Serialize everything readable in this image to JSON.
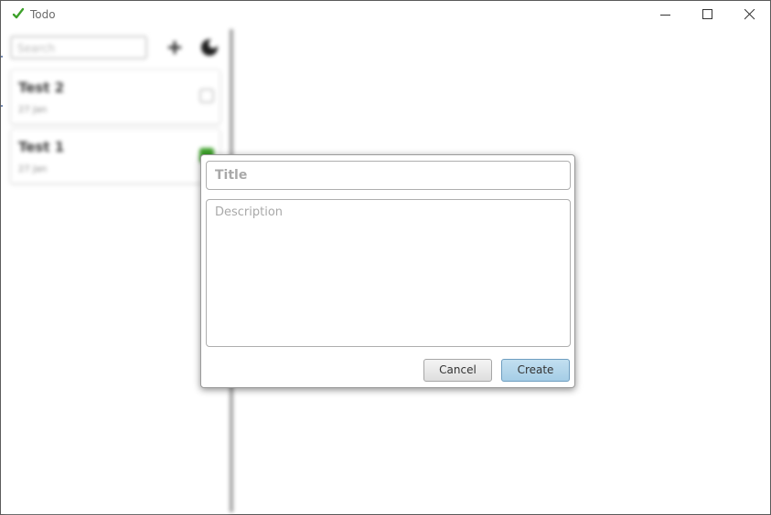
{
  "window": {
    "title": "Todo",
    "accent_color": "#3ea12b",
    "controls": [
      "minimize-icon",
      "maximize-icon",
      "close-icon"
    ]
  },
  "sidebar": {
    "search_placeholder": "Search",
    "add_icon": "plus-icon",
    "theme_icon": "theme-toggle-icon",
    "tasks": [
      {
        "title": "Test 2",
        "subtitle": "27 Jan",
        "done": false
      },
      {
        "title": "Test 1",
        "subtitle": "27 Jan",
        "done": true
      }
    ]
  },
  "dialog": {
    "title_placeholder": "Title",
    "description_placeholder": "Description",
    "cancel_label": "Cancel",
    "create_label": "Create",
    "create_color": "#a9d0e8"
  }
}
